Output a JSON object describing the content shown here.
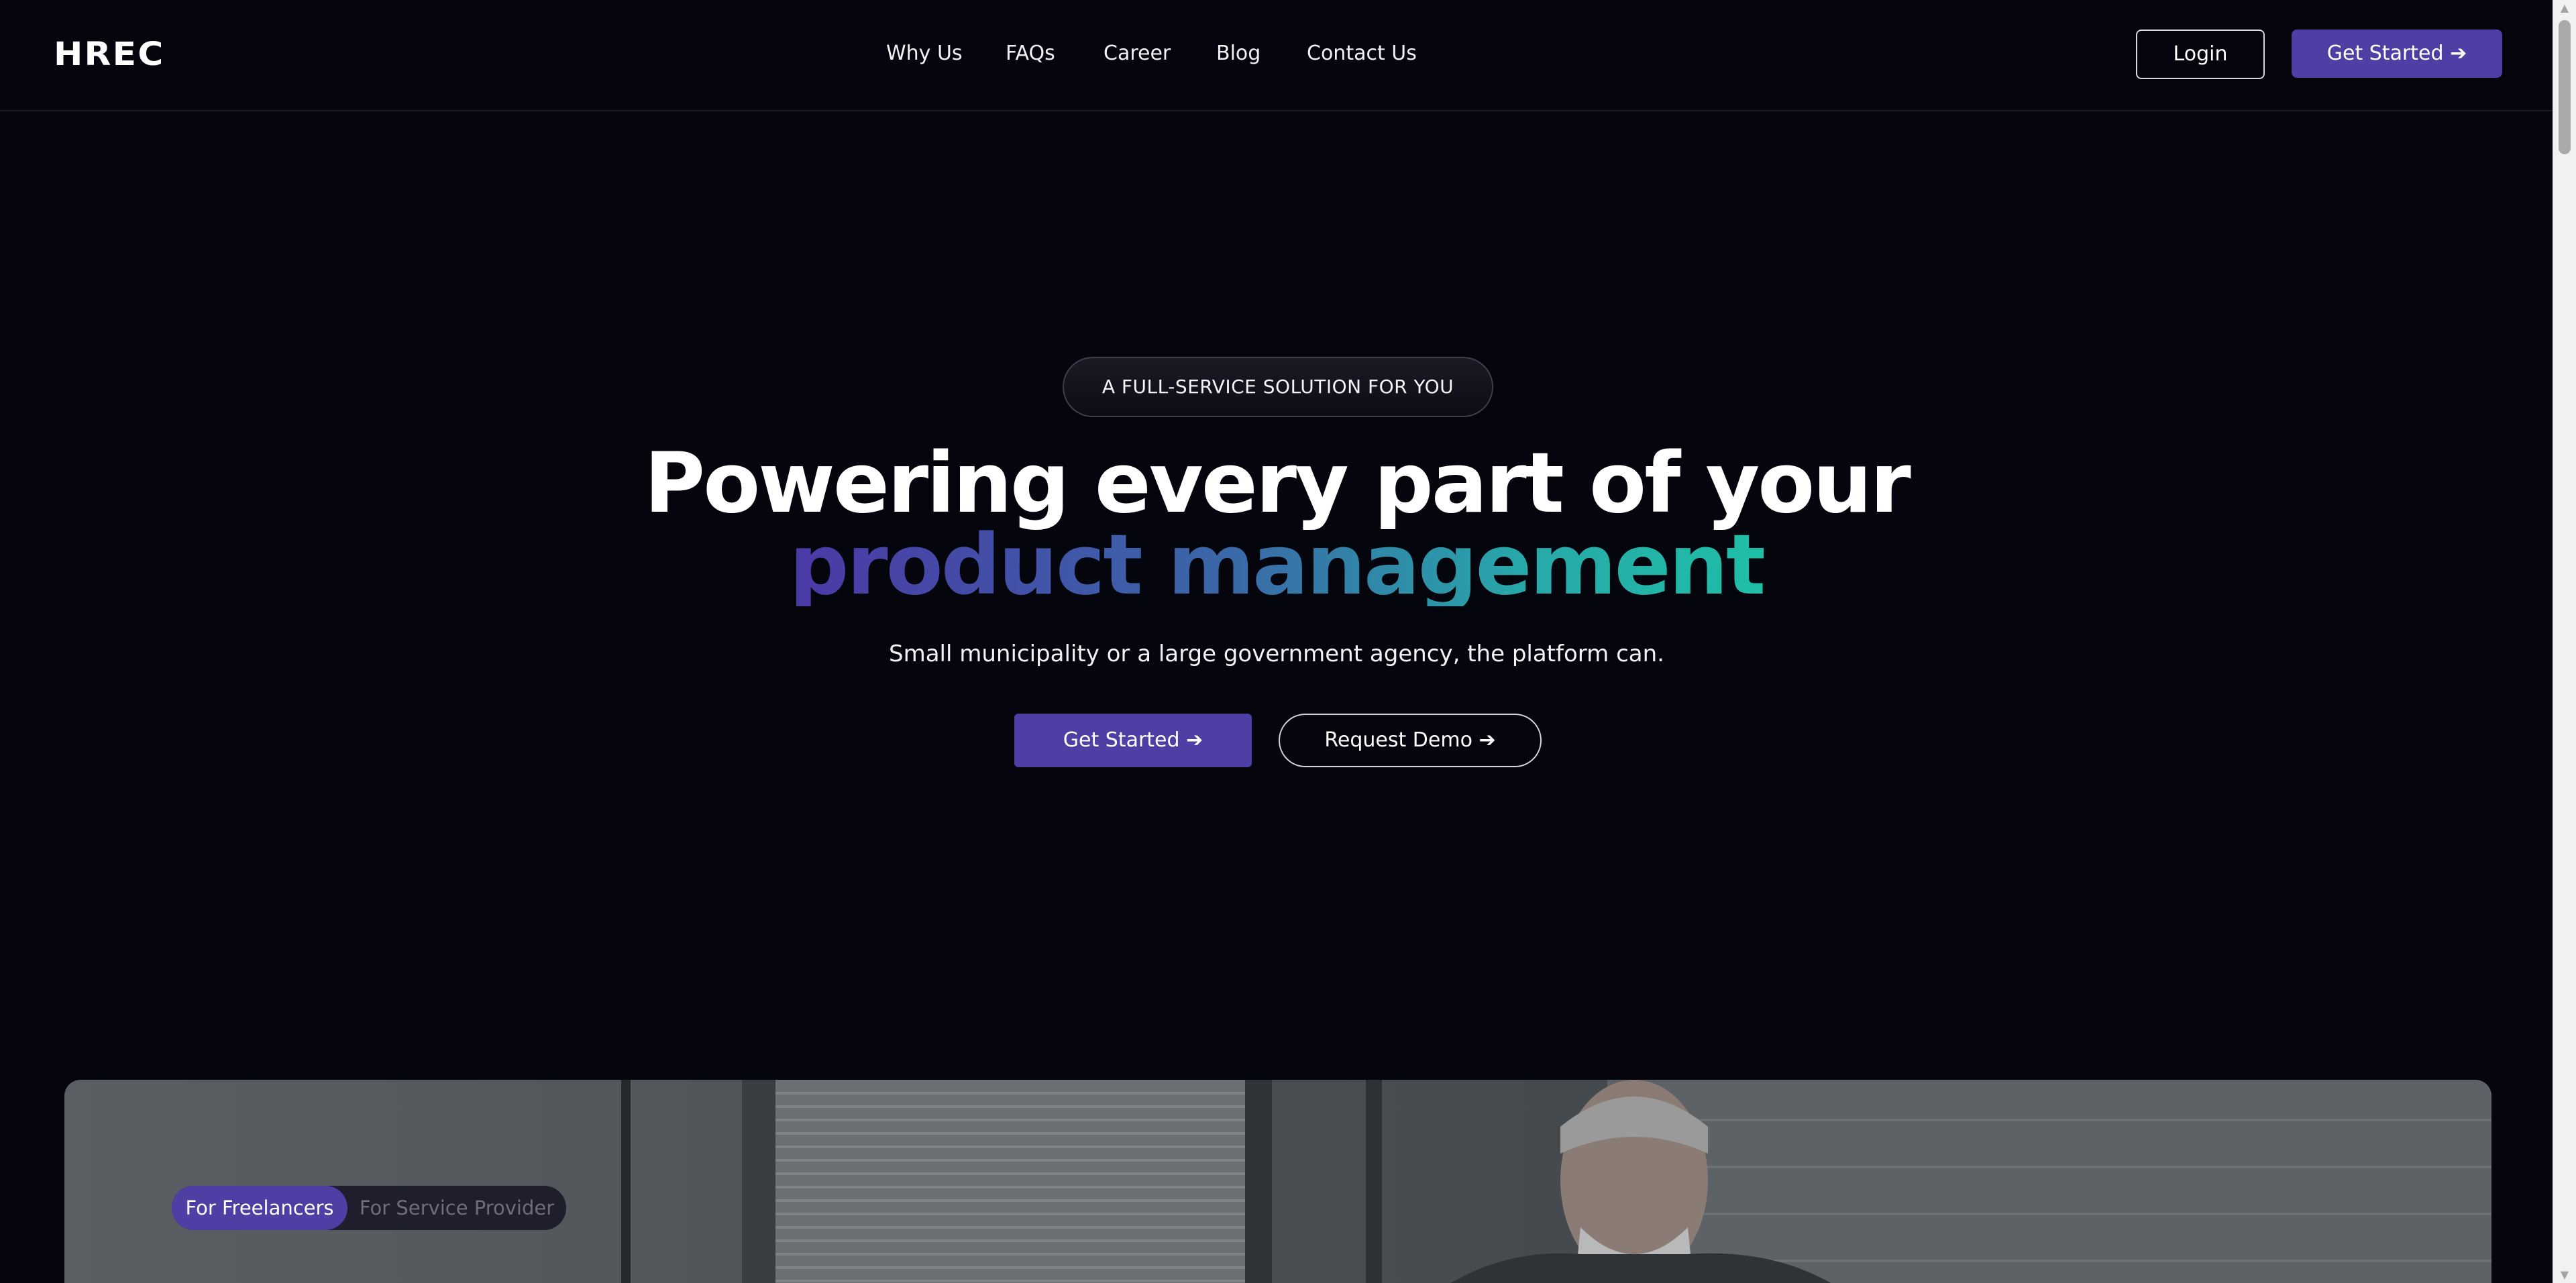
{
  "header": {
    "logo": "HREC",
    "nav": [
      "Why Us",
      "FAQs",
      "Career",
      "Blog",
      "Contact Us"
    ],
    "login_label": "Login",
    "cta_label": "Get Started ➔"
  },
  "hero": {
    "badge": "A FULL-SERVICE SOLUTION FOR YOU",
    "headline_line1": "Powering every part of your",
    "headline_line2": "product management",
    "subhead": "Small municipality or a large government agency, the platform can.",
    "primary_cta": "Get Started ➔",
    "secondary_cta": "Request Demo ➔"
  },
  "audience_toggle": {
    "active": "For Freelancers",
    "inactive": "For Service Provider"
  },
  "colors": {
    "background": "#05050d",
    "accent": "#4f3fa5",
    "gradient_start": "#4b39a6",
    "gradient_end": "#1fbfa7"
  }
}
